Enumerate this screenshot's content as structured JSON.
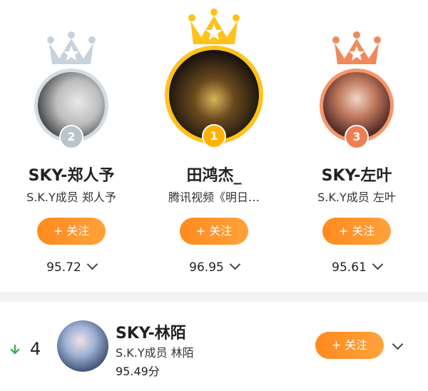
{
  "podium": [
    {
      "rank_label": "2",
      "name": "SKY-郑人予",
      "subtitle": "S.K.Y成员 郑人予",
      "follow_label": "+ 关注",
      "score": "95.72"
    },
    {
      "rank_label": "1",
      "name": "田鸿杰_",
      "subtitle": "腾讯视频《明日…",
      "follow_label": "+ 关注",
      "score": "96.95"
    },
    {
      "rank_label": "3",
      "name": "SKY-左叶",
      "subtitle": "S.K.Y成员 左叶",
      "follow_label": "+ 关注",
      "score": "95.61"
    }
  ],
  "list": [
    {
      "trend": "down-arrow-icon",
      "rank": "4",
      "name": "SKY-林陌",
      "subtitle": "S.K.Y成员 林陌",
      "score": "95.49分",
      "follow_label": "+ 关注"
    }
  ],
  "colors": {
    "gold": "#ffc21a",
    "silver": "#c8d2da",
    "bronze": "#f08a5b",
    "orange": "#ff8f25",
    "trend_down": "#3cb34a"
  },
  "icons": [
    "crown-icon",
    "chevron-down-icon",
    "down-arrow-icon"
  ]
}
